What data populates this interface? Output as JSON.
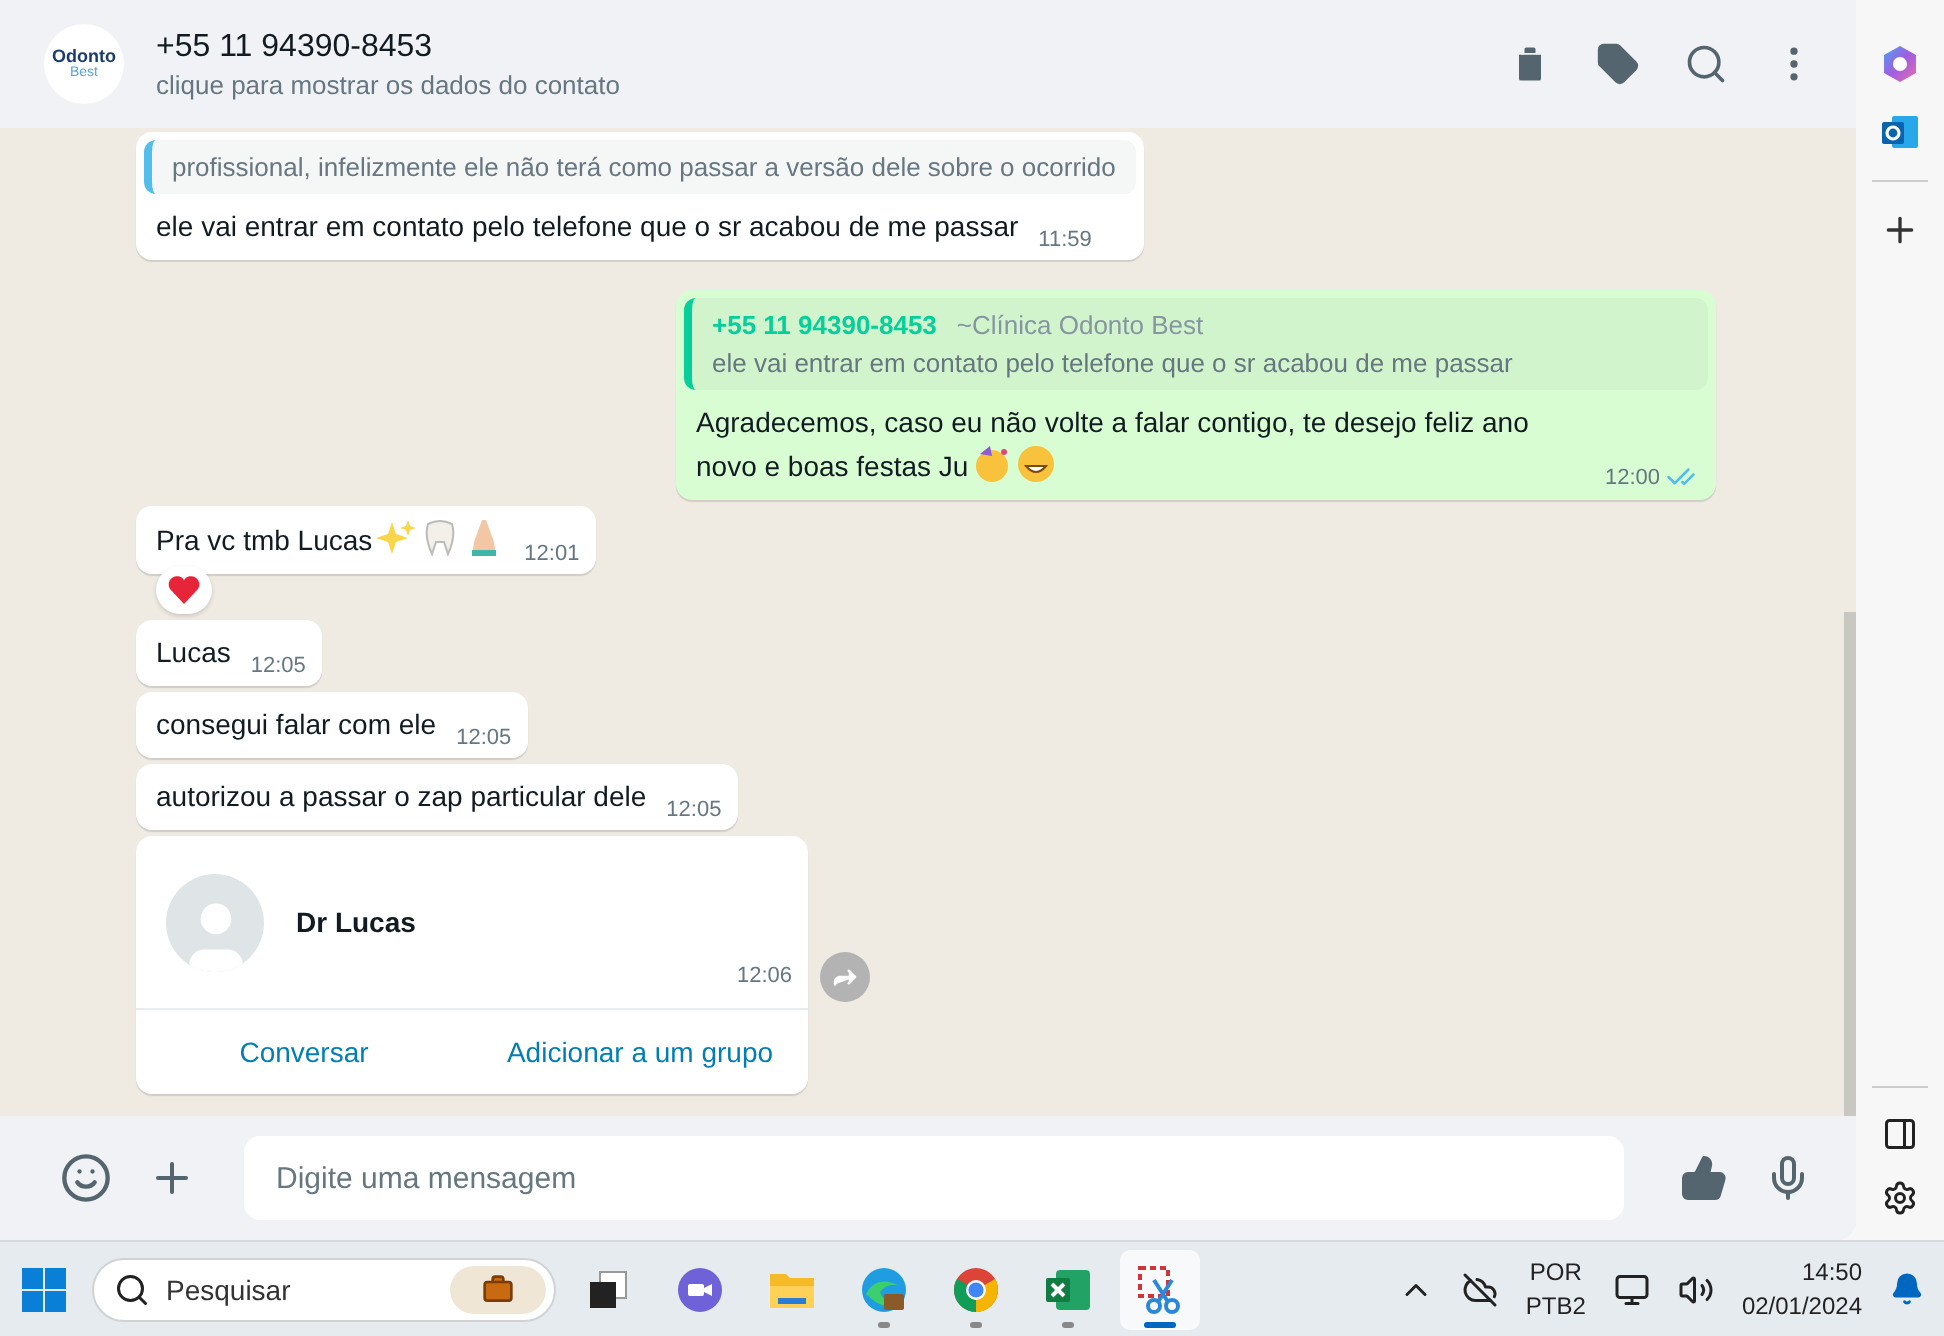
{
  "header": {
    "logo_text": [
      "Odonto",
      "Best"
    ],
    "title": "+55 11 94390-8453",
    "subtitle": "clique para mostrar os dados do contato"
  },
  "messages": [
    {
      "kind": "incoming",
      "quote_text": "profissional, infelizmente ele não terá como passar a versão dele sobre o ocorrido",
      "text": "ele vai entrar em contato pelo telefone que o sr acabou de me passar",
      "time": "11:59"
    },
    {
      "kind": "outgoing",
      "quote": {
        "author": "+55 11 94390-8453",
        "label": "~Clínica Odonto Best",
        "text": "ele vai entrar em contato pelo telefone que o sr acabou de me passar"
      },
      "text": "Agradecemos, caso eu não volte a falar contigo, te desejo feliz ano novo e boas festas Ju",
      "emojis": [
        {
          "kind": "party"
        },
        {
          "kind": "grin"
        }
      ],
      "time": "12:00",
      "read": true
    },
    {
      "kind": "incoming",
      "text": "Pra vc tmb Lucas",
      "emojis": [
        {
          "kind": "sparkles"
        },
        {
          "kind": "tooth"
        },
        {
          "kind": "pray"
        }
      ],
      "time": "12:01",
      "reaction": {
        "kind": "heart"
      }
    },
    {
      "kind": "incoming",
      "text": "Lucas",
      "time": "12:05"
    },
    {
      "kind": "incoming",
      "text": "consegui falar com ele",
      "time": "12:05"
    },
    {
      "kind": "incoming",
      "text": "autorizou a passar o zap particular dele",
      "time": "12:05"
    },
    {
      "kind": "contact",
      "name": "Dr Lucas",
      "time": "12:06",
      "actions": [
        "Conversar",
        "Adicionar a um grupo"
      ]
    }
  ],
  "composer": {
    "placeholder": "Digite uma mensagem"
  },
  "taskbar": {
    "search_placeholder": "Pesquisar",
    "apps": [
      {
        "kind": "taskview",
        "running": false,
        "selected": false
      },
      {
        "kind": "teams",
        "running": false,
        "selected": false
      },
      {
        "kind": "files",
        "running": false,
        "selected": false
      },
      {
        "kind": "edge",
        "running": true,
        "selected": false
      },
      {
        "kind": "chrome",
        "running": true,
        "selected": false
      },
      {
        "kind": "excel",
        "running": true,
        "selected": false
      },
      {
        "kind": "snip",
        "running": true,
        "selected": true
      }
    ],
    "language": "POR",
    "layout": "PTB2",
    "time": "14:50",
    "date": "02/01/2024"
  }
}
